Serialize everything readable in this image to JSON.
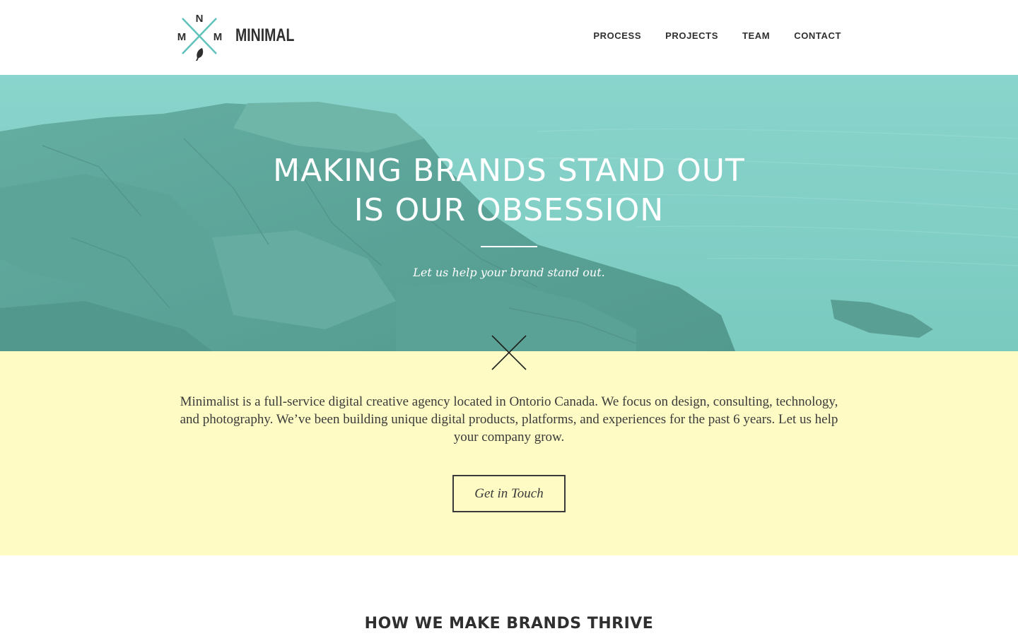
{
  "brand": {
    "logo_letters": {
      "top": "N",
      "left": "M",
      "right": "M"
    },
    "name": "MINIMAL",
    "accent_color": "#5fc2bb"
  },
  "nav": {
    "items": [
      {
        "label": "PROCESS"
      },
      {
        "label": "PROJECTS"
      },
      {
        "label": "TEAM"
      },
      {
        "label": "CONTACT"
      }
    ]
  },
  "hero": {
    "title_line1": "MAKING BRANDS STAND OUT",
    "title_line2": "IS OUR OBSESSION",
    "tagline": "Let us help your brand stand out."
  },
  "intro": {
    "text": "Minimalist is a full-service digital creative agency located in Ontorio Canada. We focus on design, consulting, technology, and photography. We’ve been building unique digital products, platforms, and experiences for the past 6 years. Let us help your company grow.",
    "cta_label": "Get in Touch",
    "background": "#fefcc4"
  },
  "process": {
    "heading": "HOW WE MAKE BRANDS THRIVE"
  }
}
